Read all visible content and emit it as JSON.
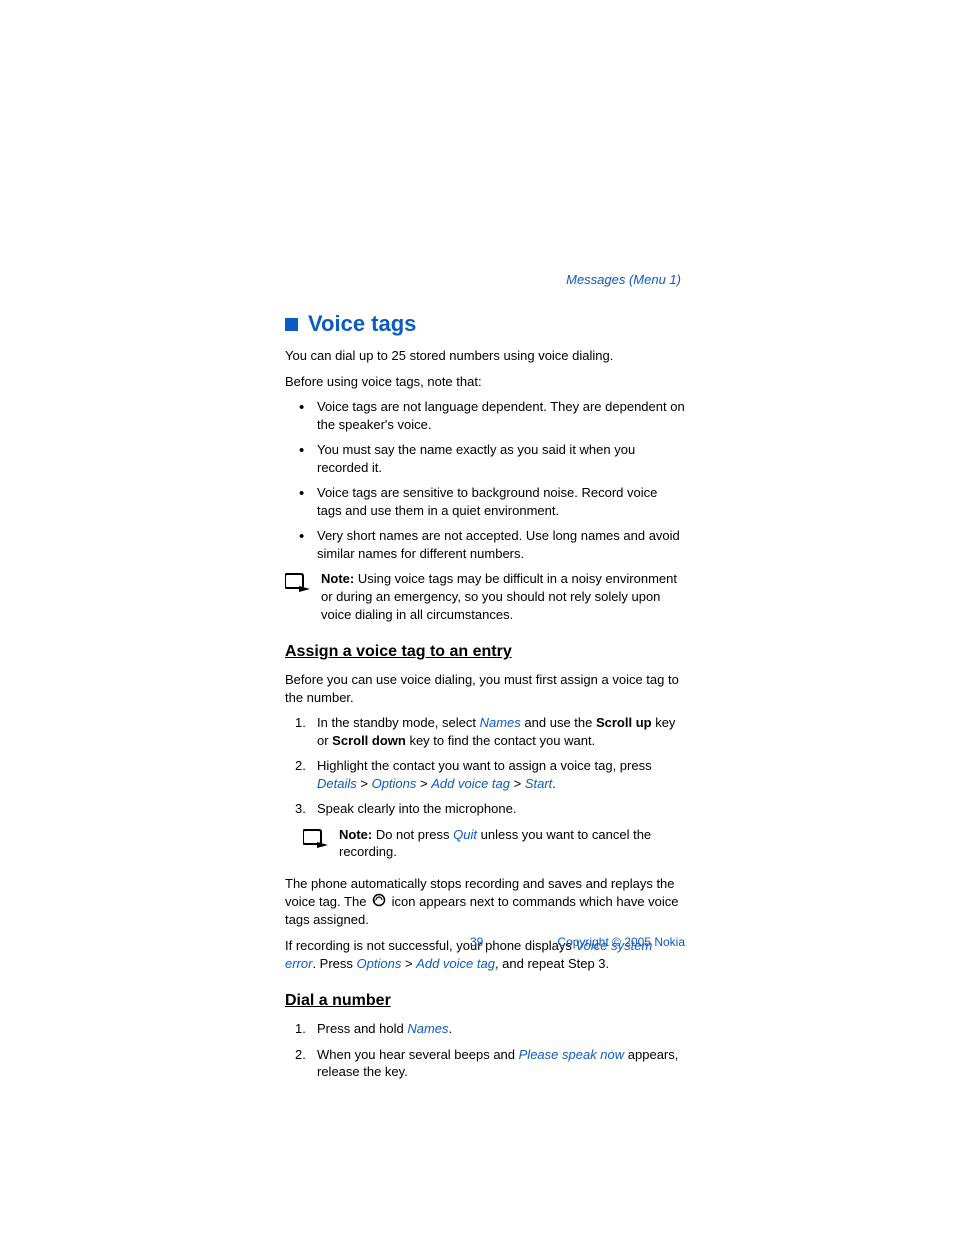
{
  "header": {
    "link": "Messages (Menu 1)"
  },
  "section": {
    "title": "Voice tags"
  },
  "intro": {
    "p1": "You can dial up to 25 stored numbers using voice dialing.",
    "p2": "Before using voice tags, note that:"
  },
  "bullets": [
    "Voice tags are not language dependent. They are dependent on the speaker's voice.",
    "You must say the name exactly as you said it when you recorded it.",
    "Voice tags are sensitive to background noise. Record voice tags and use them in a quiet environment.",
    "Very short names are not accepted. Use long names and avoid similar names for different numbers."
  ],
  "note1": {
    "label": "Note:",
    "text": " Using voice tags may be difficult in a noisy environment or during an emergency, so you should not rely solely upon voice dialing in all circumstances."
  },
  "assign": {
    "heading": "Assign a voice tag to an entry",
    "intro": "Before you can use voice dialing, you must first assign a voice tag to the number.",
    "step1": {
      "a": "In the standby mode, select ",
      "names": "Names",
      "b": " and use the ",
      "scrollup": "Scroll up",
      "c": " key or ",
      "scrolldown": "Scroll down",
      "d": " key to find the contact you want."
    },
    "step2": {
      "a": "Highlight the contact you want to assign a voice tag, press ",
      "details": "Details",
      "gt1": " > ",
      "options": "Options",
      "gt2": " > ",
      "addvoicetag": "Add voice tag",
      "gt3": " > ",
      "start": "Start",
      "b": "."
    },
    "step3": "Speak clearly into the microphone."
  },
  "note2": {
    "label": "Note:",
    "a": " Do not press ",
    "quit": "Quit",
    "b": " unless you want to cancel the recording."
  },
  "afternote": {
    "p1a": "The phone automatically stops recording and saves and replays the voice tag. The ",
    "p1b": " icon appears next to commands which have voice tags assigned.",
    "p2a": "If recording is not successful, your phone displays ",
    "vse": "Voice system error",
    "p2b": ". Press ",
    "options": "Options",
    "gt": " > ",
    "addvoicetag": "Add voice tag",
    "p2c": ", and repeat Step 3."
  },
  "dial": {
    "heading": "Dial a number",
    "step1": {
      "a": "Press and hold ",
      "names": "Names",
      "b": "."
    },
    "step2": {
      "a": "When you hear several beeps and ",
      "psn": "Please speak now",
      "b": " appears, release the key."
    }
  },
  "footer": {
    "page": "39",
    "copyright": "Copyright © 2005 Nokia"
  }
}
